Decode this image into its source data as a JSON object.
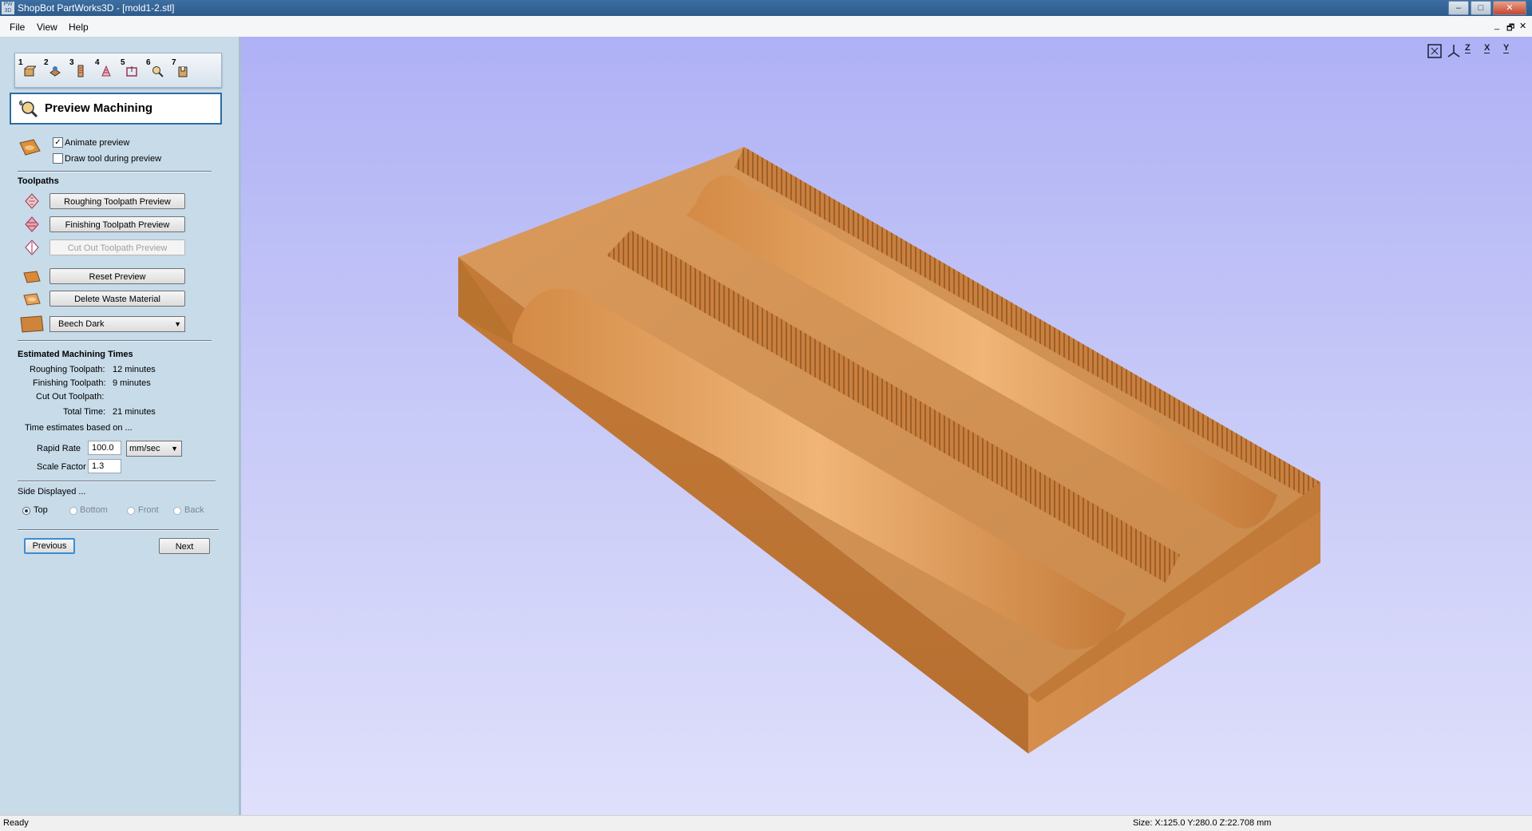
{
  "window": {
    "app_badge": "PW 3D",
    "title": "ShopBot PartWorks3D - [mold1-2.stl]",
    "controls": [
      "–",
      "□",
      "✕"
    ],
    "mdi_controls": [
      "_",
      "🗗",
      "✕"
    ]
  },
  "menu": {
    "items": [
      "File",
      "View",
      "Help"
    ]
  },
  "stage_tabs": [
    {
      "num": "1",
      "icon": "material-setup-icon"
    },
    {
      "num": "2",
      "icon": "orientation-icon"
    },
    {
      "num": "3",
      "icon": "roughing-icon"
    },
    {
      "num": "4",
      "icon": "finishing-icon"
    },
    {
      "num": "5",
      "icon": "cutout-icon"
    },
    {
      "num": "6",
      "icon": "preview-icon"
    },
    {
      "num": "7",
      "icon": "save-toolpath-icon"
    }
  ],
  "stage": {
    "num": "6",
    "title": "Preview Machining"
  },
  "options": {
    "animate_label": "Animate preview",
    "animate_checked": true,
    "draw_tool_label": "Draw tool during preview",
    "draw_tool_checked": false
  },
  "toolpaths": {
    "heading": "Toolpaths",
    "roughing_btn": "Roughing Toolpath Preview",
    "finishing_btn": "Finishing Toolpath Preview",
    "cutout_btn": "Cut Out Toolpath Preview",
    "reset_btn": "Reset Preview",
    "delete_btn": "Delete Waste Material",
    "material": "Beech Dark"
  },
  "times": {
    "heading": "Estimated Machining Times",
    "roughing_label": "Roughing Toolpath:",
    "roughing_value": "12 minutes",
    "finishing_label": "Finishing Toolpath:",
    "finishing_value": "9 minutes",
    "cutout_label": "Cut Out Toolpath:",
    "cutout_value": "",
    "total_label": "Total Time:",
    "total_value": "21 minutes",
    "based_on": "Time estimates based on ...",
    "rapid_label": "Rapid Rate",
    "rapid_value": "100.0",
    "rapid_unit": "mm/sec",
    "scale_label": "Scale Factor",
    "scale_value": "1.3"
  },
  "side": {
    "heading": "Side Displayed ...",
    "options": [
      "Top",
      "Bottom",
      "Front",
      "Back"
    ],
    "selected": "Top"
  },
  "nav": {
    "previous": "Previous",
    "next": "Next"
  },
  "view_toolbar": [
    "fit-view-icon",
    "iso-view-icon",
    "z-view-icon",
    "x-view-icon",
    "y-view-icon"
  ],
  "view_labels": {
    "z": "Z",
    "x": "X",
    "y": "Y"
  },
  "status": {
    "left": "Ready",
    "right": "Size: X:125.0 Y:280.0 Z:22.708 mm"
  },
  "colors": {
    "wood_light": "#d99a5c",
    "wood_mid": "#c97f3e",
    "wood_dark": "#a8652c",
    "background_top": "#afb1f6"
  }
}
